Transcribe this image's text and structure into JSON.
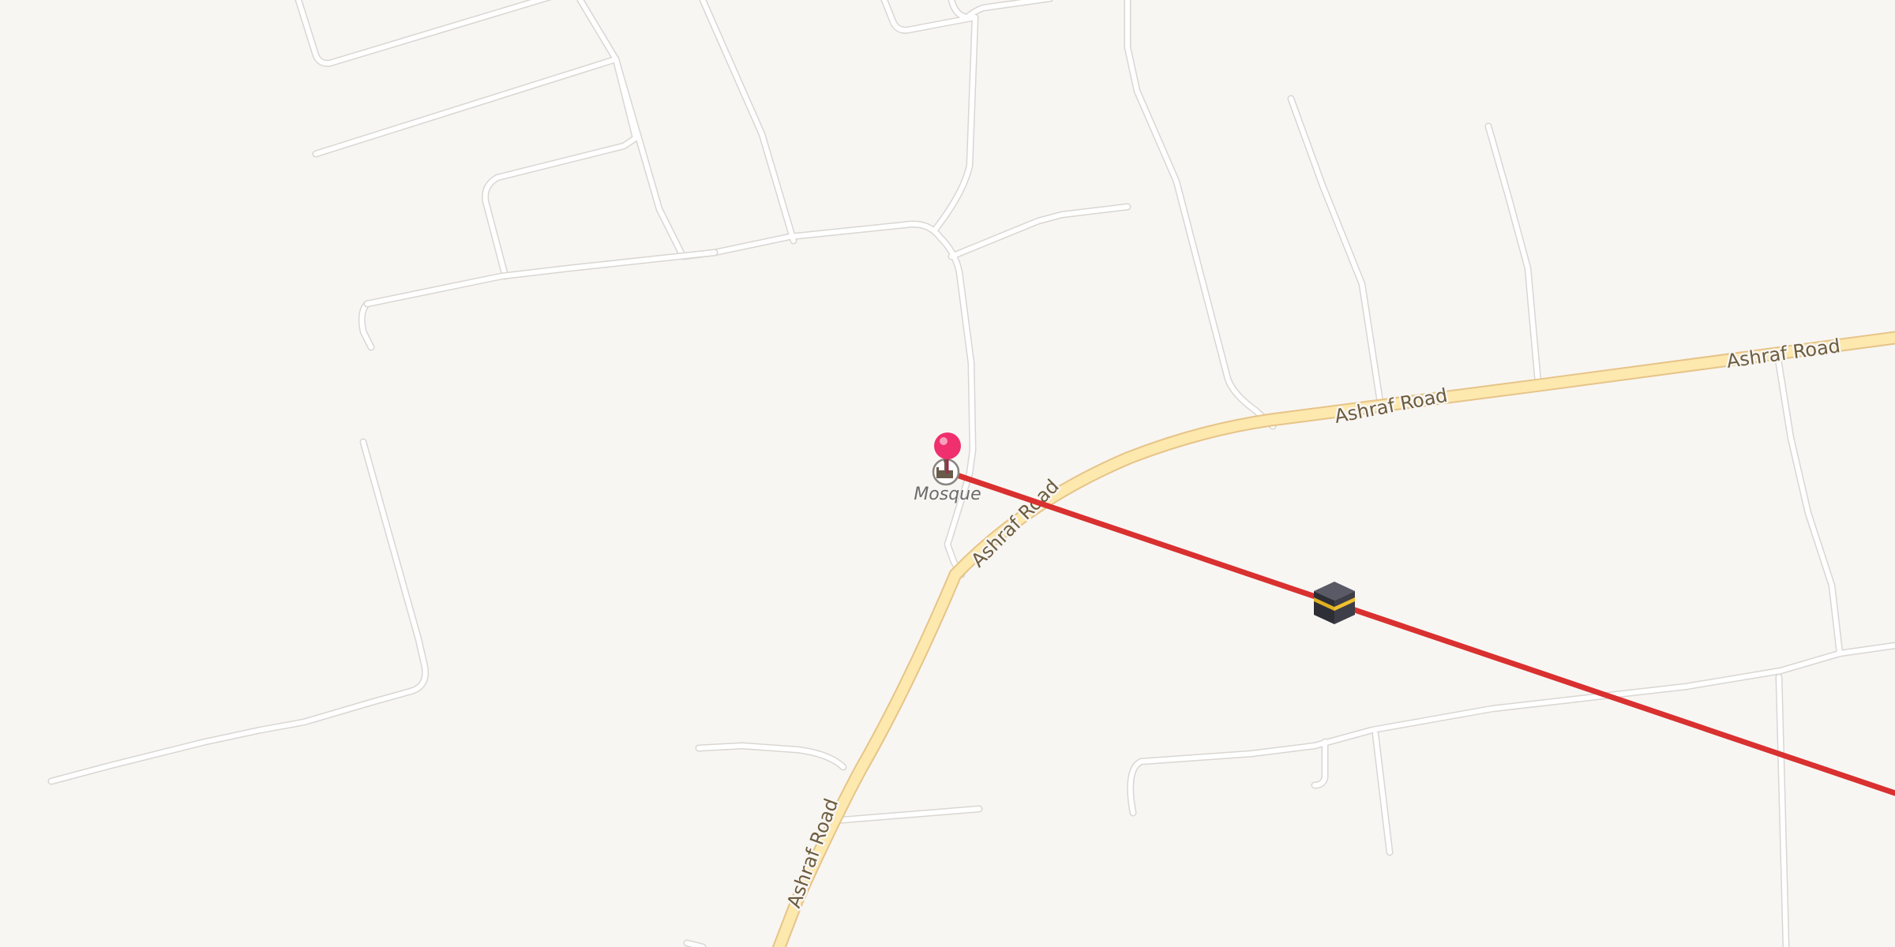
{
  "map": {
    "road_name": "Ashraf Road",
    "poi": {
      "label": "Mosque",
      "icon": "mosque-icon"
    },
    "destination_marker_icon": "kaaba-icon",
    "location_pin_icon": "location-pin-icon",
    "colors": {
      "background": "#f8f6f3",
      "minor_road": "#ffffff",
      "main_road": "#fde8ae",
      "main_road_casing": "#e6c488",
      "direction_line": "#d93030",
      "pin": "#ef2f6e"
    }
  }
}
